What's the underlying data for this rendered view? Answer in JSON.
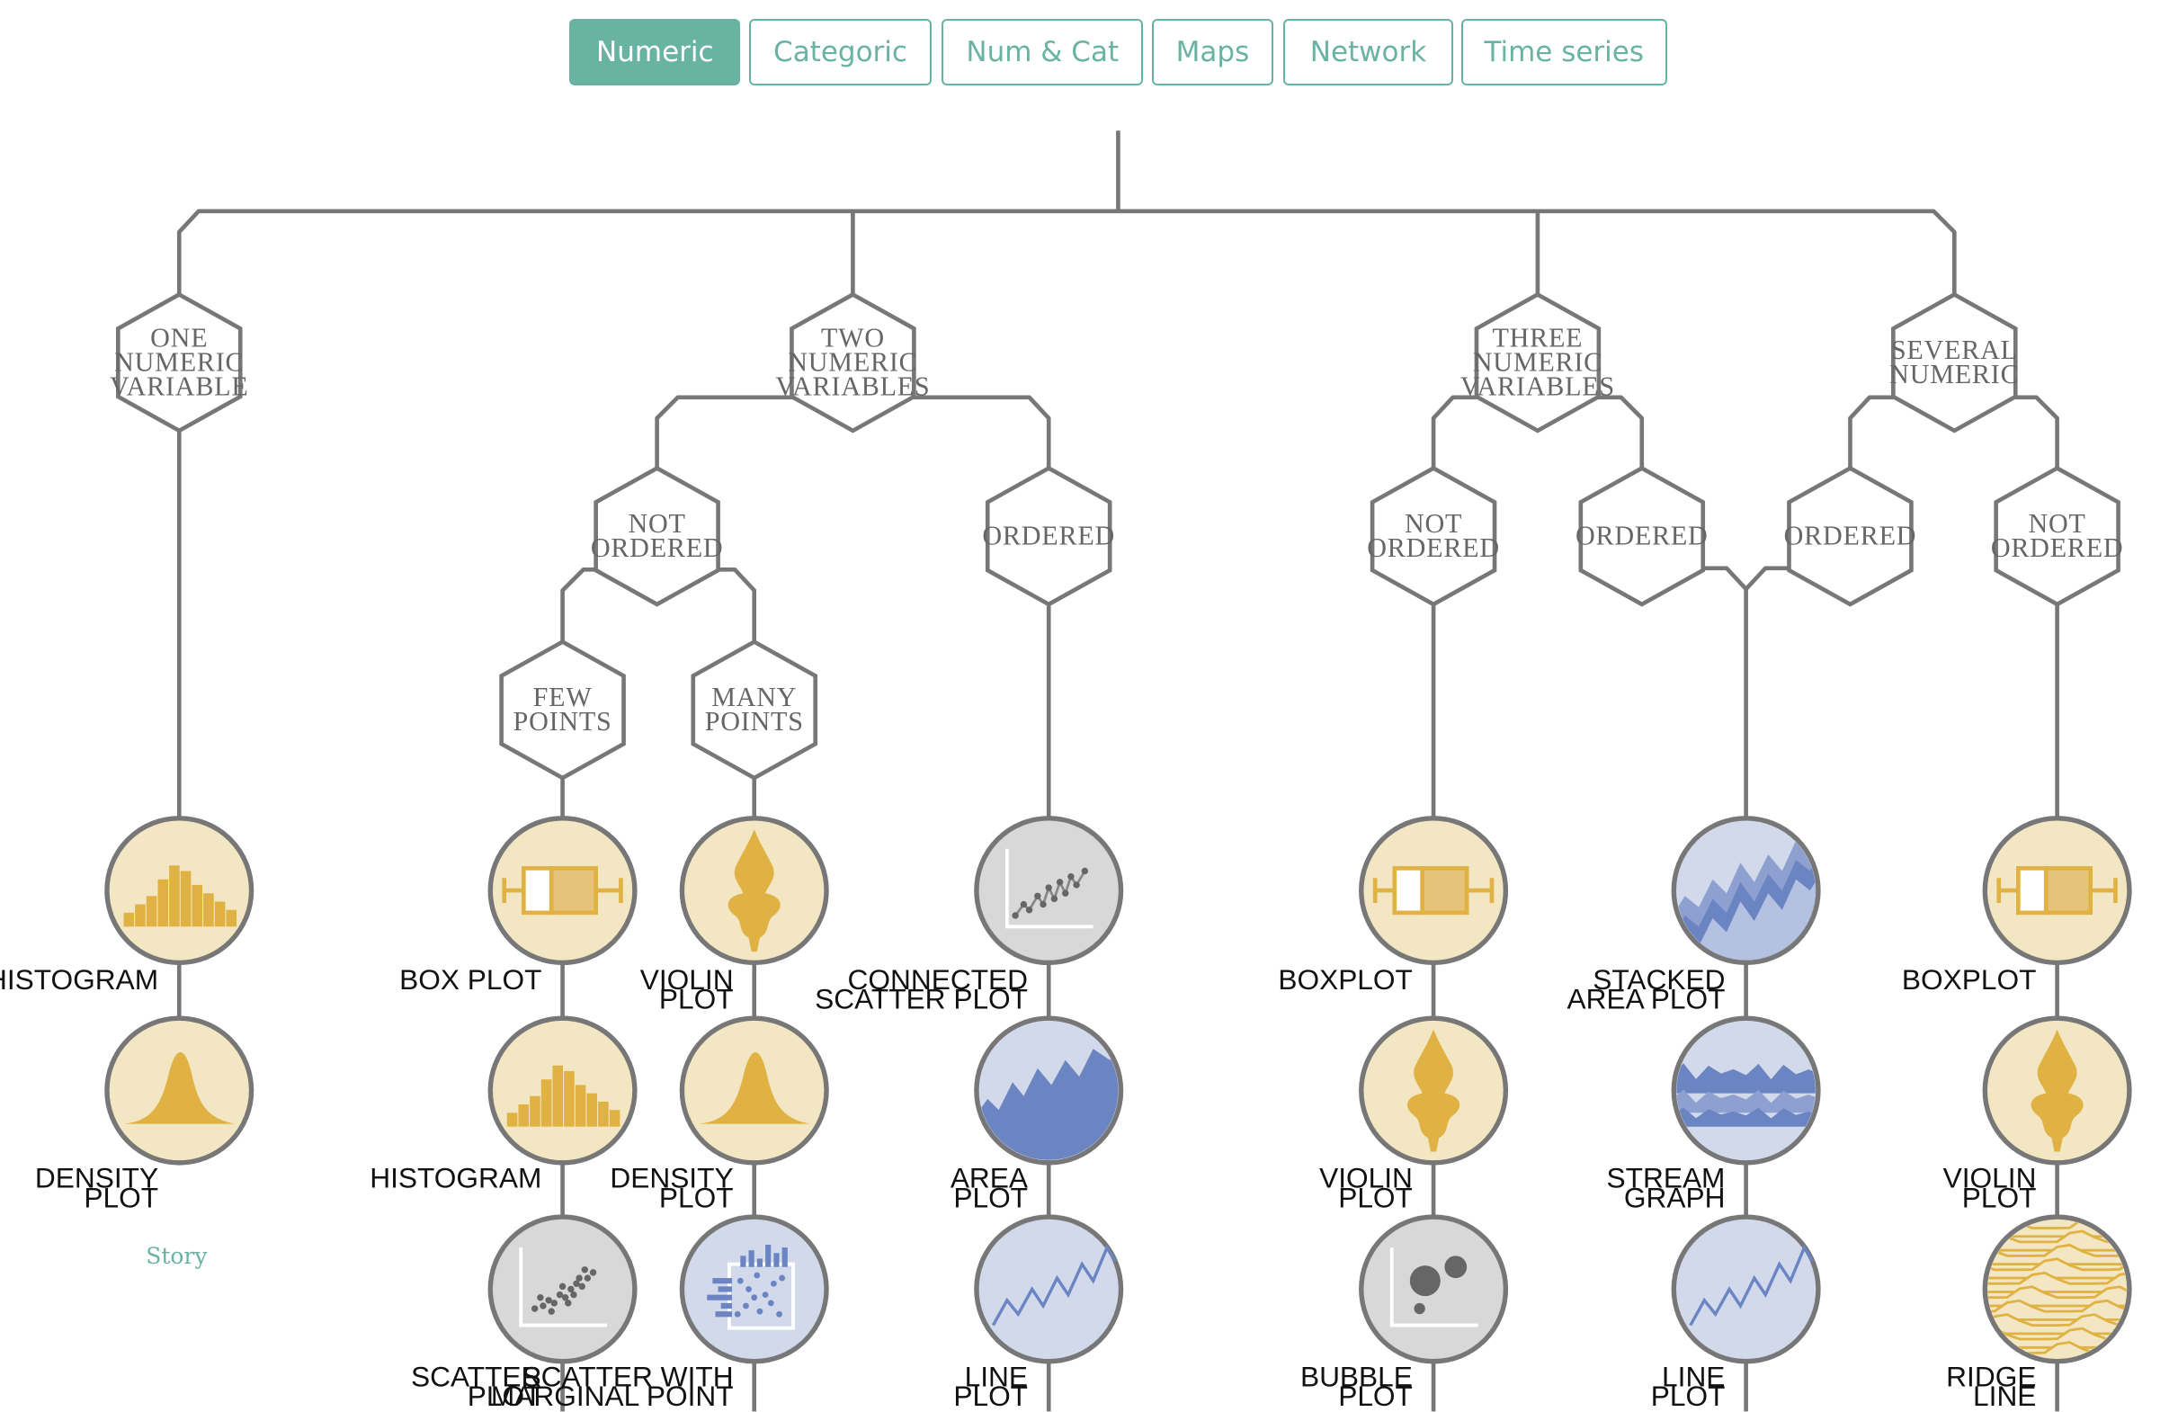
{
  "tabs": [
    "Numeric",
    "Categoric",
    "Num & Cat",
    "Maps",
    "Network",
    "Time series"
  ],
  "active_tab": "Numeric",
  "hexagons": {
    "one_numeric": [
      "ONE",
      "NUMERIC",
      "VARIABLE"
    ],
    "two_numeric": [
      "TWO",
      "NUMERIC",
      "VARIABLES"
    ],
    "three_numeric": [
      "THREE",
      "NUMERIC",
      "VARIABLES"
    ],
    "several_numeric": [
      "SEVERAL",
      "NUMERIC"
    ],
    "two_not_ordered": [
      "NOT",
      "ORDERED"
    ],
    "two_ordered": [
      "ORDERED"
    ],
    "few_points": [
      "FEW",
      "POINTS"
    ],
    "many_points": [
      "MANY",
      "POINTS"
    ],
    "three_not_ordered": [
      "NOT",
      "ORDERED"
    ],
    "three_ordered": [
      "ORDERED"
    ],
    "several_ordered": [
      "ORDERED"
    ],
    "several_not_ordered": [
      "NOT",
      "ORDERED"
    ]
  },
  "leaves": {
    "one": [
      [
        "HISTOGRAM"
      ],
      [
        "DENSITY",
        "PLOT"
      ]
    ],
    "few": [
      [
        "BOX PLOT"
      ],
      [
        "HISTOGRAM"
      ],
      [
        "SCATTER",
        "PLOT"
      ]
    ],
    "many": [
      [
        "VIOLIN",
        "PLOT"
      ],
      [
        "DENSITY",
        "PLOT"
      ],
      [
        "SCATTER WITH",
        "MARGINAL POINT"
      ]
    ],
    "ordered2": [
      [
        "CONNECTED",
        "SCATTER PLOT"
      ],
      [
        "AREA",
        "PLOT"
      ],
      [
        "LINE",
        "PLOT"
      ]
    ],
    "notord3": [
      [
        "BOXPLOT"
      ],
      [
        "VIOLIN",
        "PLOT"
      ],
      [
        "BUBBLE",
        "PLOT"
      ]
    ],
    "ord3": [
      [
        "STACKED",
        "AREA PLOT"
      ],
      [
        "STREAM",
        "GRAPH"
      ],
      [
        "LINE",
        "PLOT"
      ]
    ],
    "notordsev": [
      [
        "BOXPLOT"
      ],
      [
        "VIOLIN",
        "PLOT"
      ],
      [
        "RIDGE",
        "LINE"
      ]
    ]
  },
  "story_label": "Story",
  "colors": {
    "accent": "#69b3a2",
    "line": "#777777",
    "yellow_bg": "#f3e6c2",
    "yellow": "#e0b243",
    "blue_bg": "#d2d9eb",
    "blue": "#6a85c2",
    "grey_bg": "#d8d8d8",
    "grey": "#666666"
  }
}
